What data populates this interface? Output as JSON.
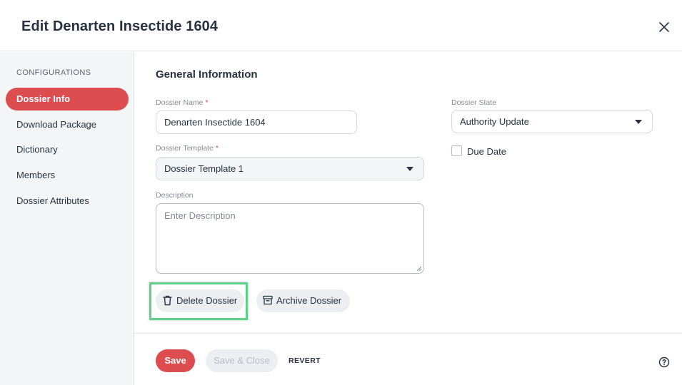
{
  "dialog": {
    "title": "Edit Denarten Insectide 1604",
    "close_icon": "close-icon"
  },
  "sidebar": {
    "section_label": "CONFIGURATIONS",
    "items": [
      {
        "label": "Dossier Info",
        "active": true
      },
      {
        "label": "Download Package",
        "active": false
      },
      {
        "label": "Dictionary",
        "active": false
      },
      {
        "label": "Members",
        "active": false
      },
      {
        "label": "Dossier Attributes",
        "active": false
      }
    ]
  },
  "form": {
    "section_title": "General Information",
    "dossier_name": {
      "label": "Dossier Name",
      "required_mark": "*",
      "value": "Denarten Insectide 1604"
    },
    "dossier_template": {
      "label": "Dossier Template",
      "required_mark": "*",
      "value": "Dossier Template 1"
    },
    "description": {
      "label": "Description",
      "placeholder": "Enter Description",
      "value": ""
    },
    "dossier_state": {
      "label": "Dossier State",
      "value": "Authority Update"
    },
    "due_date": {
      "label": "Due Date",
      "checked": false
    }
  },
  "actions": {
    "delete_label": "Delete Dossier",
    "archive_label": "Archive Dossier"
  },
  "footer": {
    "save_label": "Save",
    "save_close_label": "Save & Close",
    "revert_label": "REVERT",
    "help_icon": "help-circle-icon"
  },
  "colors": {
    "accent": "#dd4d50",
    "highlight": "#5ed28a",
    "sidebar_bg": "#f4f5f7"
  }
}
